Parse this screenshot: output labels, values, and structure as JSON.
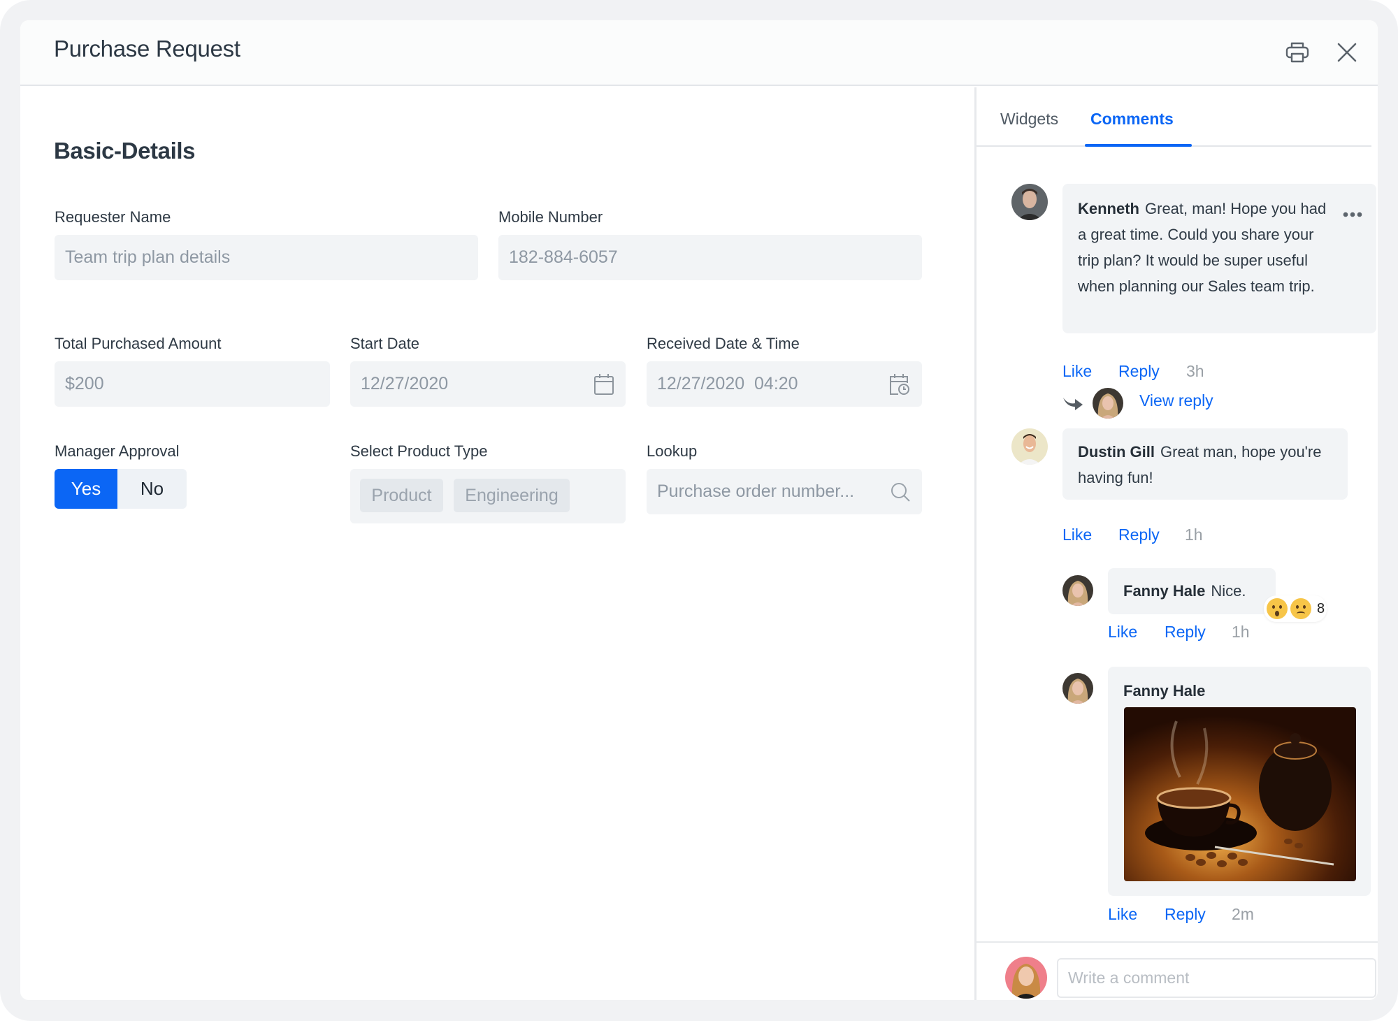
{
  "dialog": {
    "title": "Purchase Request",
    "print_icon": "printer-icon",
    "close_icon": "close-icon"
  },
  "form": {
    "section_title": "Basic-Details",
    "requester_name": {
      "label": "Requester Name",
      "value": "Team trip plan details"
    },
    "mobile_number": {
      "label": "Mobile Number",
      "value": "182-884-6057"
    },
    "total_amount": {
      "label": "Total Purchased Amount",
      "value": "$200"
    },
    "start_date": {
      "label": "Start Date",
      "value": "12/27/2020",
      "icon": "calendar-icon"
    },
    "received_datetime": {
      "label": "Received Date & Time",
      "value": "12/27/2020  04:20",
      "icon": "calendar-clock-icon"
    },
    "manager_approval": {
      "label": "Manager Approval",
      "options": [
        "Yes",
        "No"
      ],
      "selected": "Yes"
    },
    "product_type": {
      "label": "Select Product Type",
      "chips": [
        "Product",
        "Engineering"
      ]
    },
    "lookup": {
      "label": "Lookup",
      "placeholder": "Purchase order number...",
      "icon": "search-icon"
    }
  },
  "side_panel": {
    "tabs": [
      {
        "label": "Widgets",
        "active": false
      },
      {
        "label": "Comments",
        "active": true
      }
    ],
    "comments": [
      {
        "author": "Kenneth",
        "text": "Great, man! Hope you had a great time. Could you share your trip plan? It would be super useful when planning our Sales team trip.",
        "like": "Like",
        "reply": "Reply",
        "time": "3h",
        "view_reply": "View reply"
      },
      {
        "author": "Dustin Gill",
        "text": "Great man, hope you're having fun!",
        "like": "Like",
        "reply": "Reply",
        "time": "1h",
        "replies": [
          {
            "author": "Fanny Hale",
            "text": "Nice.",
            "reactions": {
              "emojis": [
                "surprised",
                "sad"
              ],
              "count": "8"
            },
            "like": "Like",
            "reply": "Reply",
            "time": "1h"
          },
          {
            "author": "Fanny Hale",
            "attachment": "coffee cup and teapot photo",
            "like": "Like",
            "reply": "Reply",
            "time": "2m"
          }
        ]
      }
    ],
    "composer": {
      "placeholder": "Write a comment"
    }
  },
  "colors": {
    "accent": "#0b66f5",
    "field_bg": "#f2f4f6",
    "frame_bg": "#f1f2f4"
  }
}
